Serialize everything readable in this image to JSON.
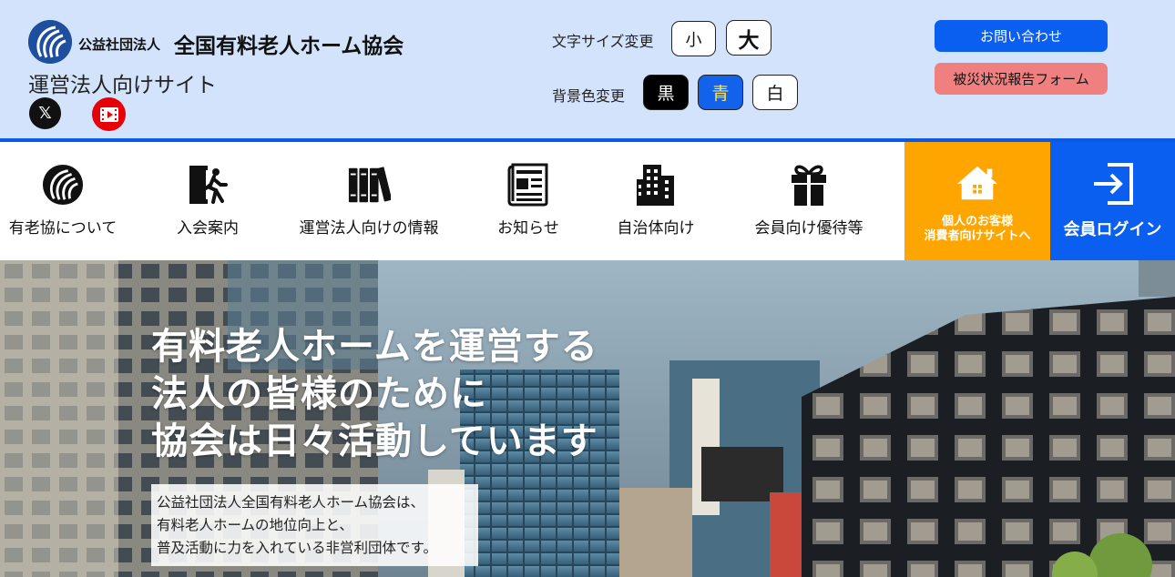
{
  "header": {
    "org_prefix": "公益社団法人",
    "org_name": "全国有料老人ホーム協会",
    "site_name": "運営法人向けサイト",
    "social": {
      "x_label": "𝕏"
    },
    "font_size": {
      "label": "文字サイズ変更",
      "small": "小",
      "large": "大"
    },
    "background": {
      "label": "背景色変更",
      "black": "黒",
      "blue": "青",
      "white": "白"
    },
    "contact_button": "お問い合わせ",
    "disaster_button": "被災状況報告フォーム"
  },
  "nav": {
    "items": [
      {
        "label": "有老協について",
        "icon": "association-logo-icon"
      },
      {
        "label": "入会案内",
        "icon": "door-entry-icon"
      },
      {
        "label": "運営法人向けの情報",
        "icon": "books-icon"
      },
      {
        "label": "お知らせ",
        "icon": "newspaper-icon"
      },
      {
        "label": "自治体向け",
        "icon": "building-icon"
      },
      {
        "label": "会員向け優待等",
        "icon": "gift-icon"
      }
    ],
    "consumer": {
      "line1": "個人のお客様",
      "line2": "消費者向けサイトへ",
      "icon": "house-icon"
    },
    "login": {
      "label": "会員ログイン",
      "icon": "login-icon"
    }
  },
  "hero": {
    "headline": [
      "有料老人ホームを運営する",
      "法人の皆様のために",
      "協会は日々活動しています"
    ],
    "description": [
      "公益社団法人全国有料老人ホーム協会は、",
      "有料老人ホームの地位向上と、",
      "普及活動に力を入れている非営利団体です。"
    ]
  },
  "colors": {
    "header_bg": "#d2e3fb",
    "accent_blue": "#0b5ff0",
    "consumer_orange": "#ffa500",
    "disaster_pink": "#f08080"
  }
}
